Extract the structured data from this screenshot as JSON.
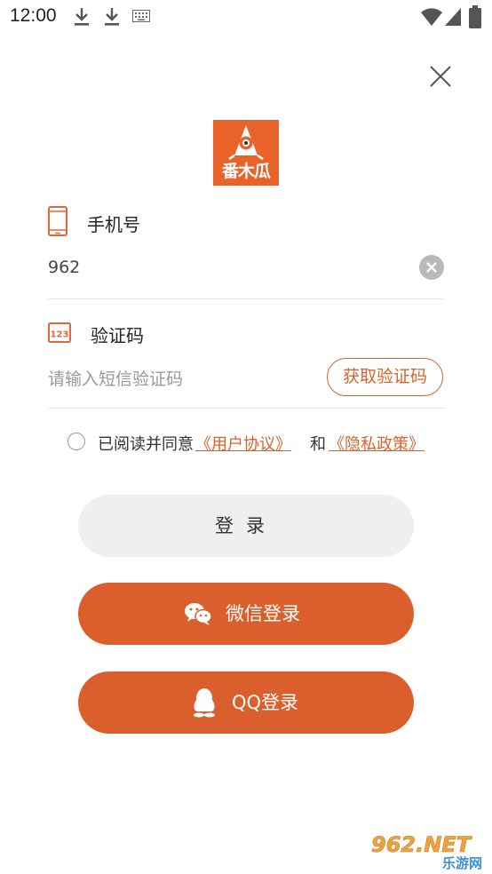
{
  "status_bar": {
    "time": "12:00",
    "icons": [
      "download-icon",
      "download-icon",
      "keyboard-icon",
      "wifi-icon",
      "signal-icon",
      "battery-icon"
    ]
  },
  "header": {
    "close_icon": "close-icon"
  },
  "logo": {
    "text": "番木瓜",
    "background": "#e8622a"
  },
  "phone_field": {
    "icon": "phone-icon",
    "label": "手机号",
    "value": "962",
    "clear_icon": "clear-icon"
  },
  "code_field": {
    "icon": "numeric-code-icon",
    "label": "验证码",
    "placeholder": "请输入短信验证码",
    "get_code_label": "获取验证码"
  },
  "agreement": {
    "checked": false,
    "prefix": "已阅读并同意",
    "user_agreement": "《用户协议》",
    "conjunction": "和",
    "privacy_policy": "《隐私政策》"
  },
  "buttons": {
    "login_label": "登录",
    "wechat_label": "微信登录",
    "wechat_icon": "wechat-icon",
    "qq_label": "QQ登录",
    "qq_icon": "qq-icon"
  },
  "watermark": {
    "text": "962.NET",
    "subtext": "乐游网"
  },
  "colors": {
    "accent": "#da5f2d",
    "login_button_bg": "#efefef",
    "divider": "#e6e6e6"
  }
}
